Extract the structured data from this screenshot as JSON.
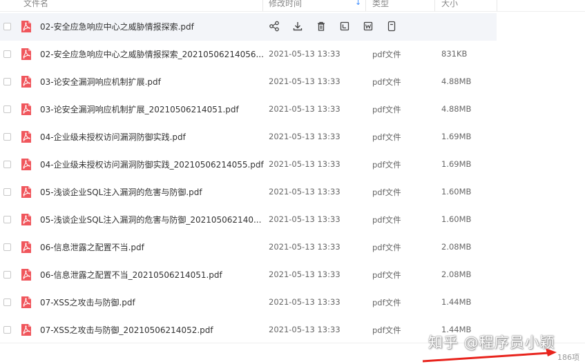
{
  "header": {
    "name_label": "文件名",
    "date_label": "修改时间",
    "type_label": "类型",
    "size_label": "大小"
  },
  "hover_actions": [
    "share-icon",
    "download-icon",
    "delete-icon",
    "rename-icon",
    "word-icon",
    "more-icon"
  ],
  "files": [
    {
      "name": "02-安全应急响应中心之威胁情报探索.pdf",
      "date": "",
      "type": "",
      "size": ""
    },
    {
      "name": "02-安全应急响应中心之威胁情报探索_20210506214056...",
      "date": "2021-05-13 13:33",
      "type": "pdf文件",
      "size": "831KB"
    },
    {
      "name": "03-论安全漏洞响应机制扩展.pdf",
      "date": "2021-05-13 13:33",
      "type": "pdf文件",
      "size": "4.88MB"
    },
    {
      "name": "03-论安全漏洞响应机制扩展_20210506214051.pdf",
      "date": "2021-05-13 13:33",
      "type": "pdf文件",
      "size": "4.88MB"
    },
    {
      "name": "04-企业级未授权访问漏洞防御实践.pdf",
      "date": "2021-05-13 13:33",
      "type": "pdf文件",
      "size": "1.69MB"
    },
    {
      "name": "04-企业级未授权访问漏洞防御实践_20210506214055.pdf",
      "date": "2021-05-13 13:33",
      "type": "pdf文件",
      "size": "1.69MB"
    },
    {
      "name": "05-浅谈企业SQL注入漏洞的危害与防御.pdf",
      "date": "2021-05-13 13:33",
      "type": "pdf文件",
      "size": "1.60MB"
    },
    {
      "name": "05-浅谈企业SQL注入漏洞的危害与防御_202105062140...",
      "date": "2021-05-13 13:33",
      "type": "pdf文件",
      "size": "1.60MB"
    },
    {
      "name": "06-信息泄露之配置不当.pdf",
      "date": "2021-05-13 13:33",
      "type": "pdf文件",
      "size": "2.08MB"
    },
    {
      "name": "06-信息泄露之配置不当_20210506214051.pdf",
      "date": "2021-05-13 13:33",
      "type": "pdf文件",
      "size": "2.08MB"
    },
    {
      "name": "07-XSS之攻击与防御.pdf",
      "date": "2021-05-13 13:33",
      "type": "pdf文件",
      "size": "1.44MB"
    },
    {
      "name": "07-XSS之攻击与防御_20210506214052.pdf",
      "date": "2021-05-13 13:33",
      "type": "pdf文件",
      "size": "1.44MB"
    }
  ],
  "footer": {
    "item_count": "186项",
    "watermark": "知乎 @程序员小颖"
  },
  "colors": {
    "pdf_icon": "#f0565c",
    "accent": "#3b8cff",
    "arrow": "#e8231c"
  }
}
